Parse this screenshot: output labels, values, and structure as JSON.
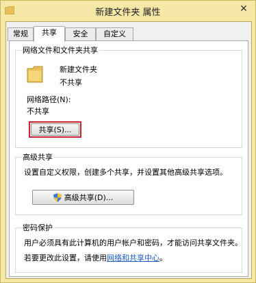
{
  "window": {
    "title": "新建文件夹 属性",
    "close_glyph": "✕"
  },
  "tabs": [
    {
      "label": "常规",
      "active": false
    },
    {
      "label": "共享",
      "active": true
    },
    {
      "label": "安全",
      "active": false
    },
    {
      "label": "自定义",
      "active": false
    }
  ],
  "network_sharing": {
    "group_title": "网络文件和文件夹共享",
    "folder_name": "新建文件夹",
    "share_status": "不共享",
    "path_label": "网络路径(N):",
    "path_value": "不共享",
    "share_button": "共享(S)..."
  },
  "advanced_sharing": {
    "group_title": "高级共享",
    "description": "设置自定义权限，创建多个共享，并设置其他高级共享选项。",
    "button": "高级共享(D)..."
  },
  "password_protection": {
    "group_title": "密码保护",
    "description": "用户必须具有此计算机的用户帐户和密码，才能访问共享文件夹。",
    "change_prefix": "若要更改此设置，请使用",
    "link": "网络和共享中心",
    "change_suffix": "。"
  },
  "colors": {
    "frame": "#f5e7a6",
    "highlight": "#d0202a",
    "link": "#1a5bbf",
    "folder": "#e8c15a"
  }
}
